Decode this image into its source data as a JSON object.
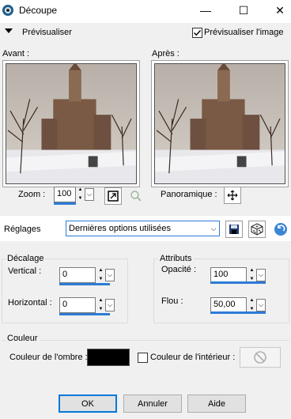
{
  "window": {
    "title": "Découpe",
    "minimize_glyph": "—",
    "maximize_glyph": "☐",
    "close_glyph": "✕"
  },
  "preview": {
    "label": "Prévisualiser",
    "image_preview_label": "Prévisualiser l'image",
    "image_preview_checked": true
  },
  "images": {
    "before_label": "Avant :",
    "after_label": "Après :"
  },
  "zoom": {
    "label": "Zoom :",
    "value": "100"
  },
  "pan": {
    "label": "Panoramique :"
  },
  "settings": {
    "label": "Réglages",
    "selected": "Dernières options utilisées"
  },
  "offset": {
    "title": "Décalage",
    "vertical_label": "Vertical :",
    "vertical_value": "0",
    "horizontal_label": "Horizontal :",
    "horizontal_value": "0"
  },
  "attributes": {
    "title": "Attributs",
    "opacity_label": "Opacité :",
    "opacity_value": "100",
    "blur_label": "Flou :",
    "blur_value": "50,00"
  },
  "color": {
    "title": "Couleur",
    "shadow_label": "Couleur de l'ombre :",
    "shadow_color": "#000000",
    "inner_label": "Couleur de l'intérieur :",
    "inner_checked": false
  },
  "buttons": {
    "ok": "OK",
    "cancel": "Annuler",
    "help": "Aide"
  },
  "colors": {
    "accent": "#2e7bd6",
    "default_border": "#0078d7"
  }
}
